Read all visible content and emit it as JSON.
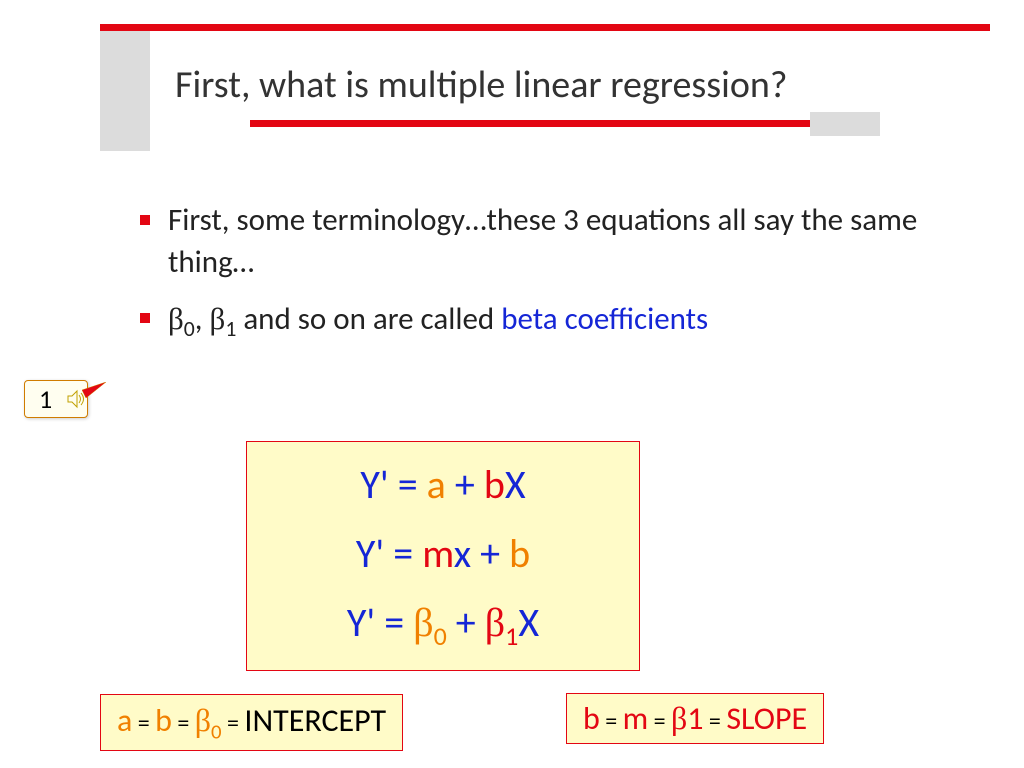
{
  "title": "First, what is multiple linear regression?",
  "bullets": {
    "b1": "First, some terminology…these 3 equations all say the same thing…",
    "b2_prefix": "",
    "b2_beta0": "β",
    "b2_zero": "0",
    "b2_comma": ", ",
    "b2_beta1": "β",
    "b2_one": "1",
    "b2_middle": " and so on are called ",
    "b2_term": "beta coefficients"
  },
  "callout": {
    "label": "1"
  },
  "equations": {
    "eq1": {
      "y": "Y' = ",
      "a": "a",
      "plus": " + ",
      "b": "b",
      "x": "X"
    },
    "eq2": {
      "y": "Y' = ",
      "m": "m",
      "x": "x",
      "plus": " + ",
      "b": "b"
    },
    "eq3": {
      "y": "Y' = ",
      "b0": "β",
      "zero": "0",
      "plus": " + ",
      "b1": "β",
      "one": "1",
      "x": "X"
    }
  },
  "bottom_left": {
    "a": "a",
    "eq1": " = ",
    "b": "b",
    "eq2": " = ",
    "beta": "β",
    "zero": "0",
    "eq3": " = ",
    "intercept": "INTERCEPT"
  },
  "bottom_right": {
    "b": "b",
    "eq1": " = ",
    "m": "m",
    "eq2": " = ",
    "beta": "β",
    "one": "1",
    "eq3": " = ",
    "slope": "SLOPE"
  }
}
